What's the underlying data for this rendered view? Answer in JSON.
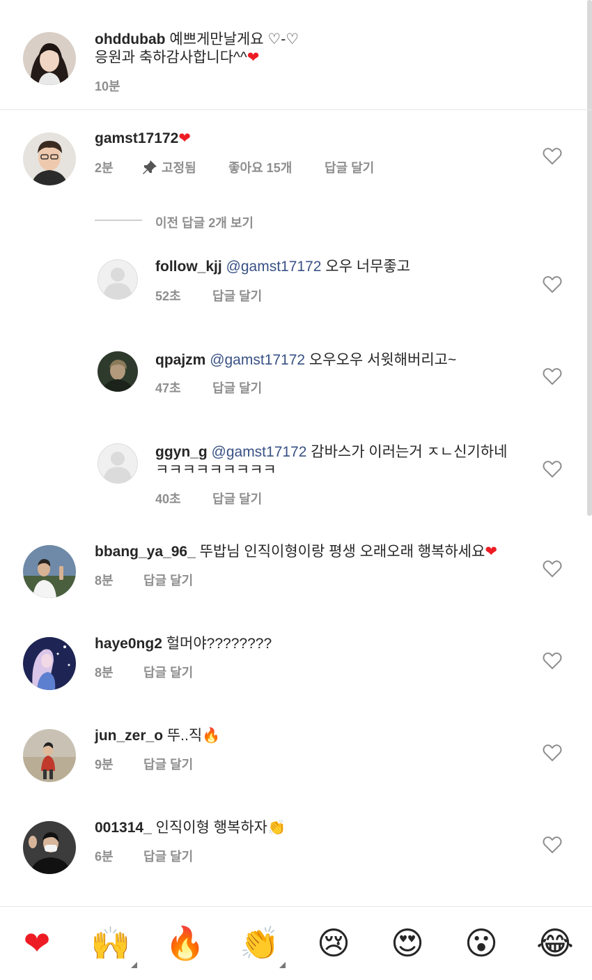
{
  "comments": {
    "top": {
      "username": "ohddubab",
      "line1": "예쁘게만날게요 ♡-♡",
      "line2": "응원과 축하감사합니다^^",
      "emoji": "❤",
      "time": "10분"
    },
    "pinned": {
      "username": "gamst17172",
      "emoji": "❤",
      "time": "2분",
      "pinned_label": "고정됨",
      "likes": "좋아요 15개",
      "reply": "답글 달기"
    },
    "view_replies": "이전 답글 2개 보기",
    "replies": [
      {
        "username": "follow_kjj",
        "mention": "@gamst17172",
        "text": " 오우 너무좋고",
        "time": "52초",
        "reply": "답글 달기"
      },
      {
        "username": "qpajzm",
        "mention": "@gamst17172",
        "text": " 오우오우 서윗해버리고~",
        "time": "47초",
        "reply": "답글 달기"
      },
      {
        "username": "ggyn_g",
        "mention": "@gamst17172",
        "text": " 감바스가 이러는거 ㅈㄴ신기하네",
        "text2": "ㅋㅋㅋㅋㅋㅋㅋㅋㅋ",
        "time": "40초",
        "reply": "답글 달기"
      }
    ],
    "others": [
      {
        "username": "bbang_ya_96_",
        "text": " 뚜밥님 인직이형이랑 평생 오래오래 행복하세요",
        "emoji": "❤",
        "time": "8분",
        "reply": "답글 달기"
      },
      {
        "username": "haye0ng2",
        "text": " 헐머야????????",
        "emoji": "",
        "time": "8분",
        "reply": "답글 달기"
      },
      {
        "username": "jun_zer_o",
        "text": " 뚜..직",
        "emoji": "🔥",
        "time": "9분",
        "reply": "답글 달기"
      },
      {
        "username": "001314_",
        "text": " 인직이형 행복하자",
        "emoji": "👏",
        "time": "6분",
        "reply": "답글 달기"
      }
    ]
  },
  "emoji_bar": [
    "❤",
    "🙌",
    "🔥",
    "👏",
    "😢",
    "😍",
    "😮",
    "😂"
  ],
  "colors": {
    "mention": "#385185",
    "meta": "#8e8e8e",
    "heart_red": "#ed1c24"
  }
}
